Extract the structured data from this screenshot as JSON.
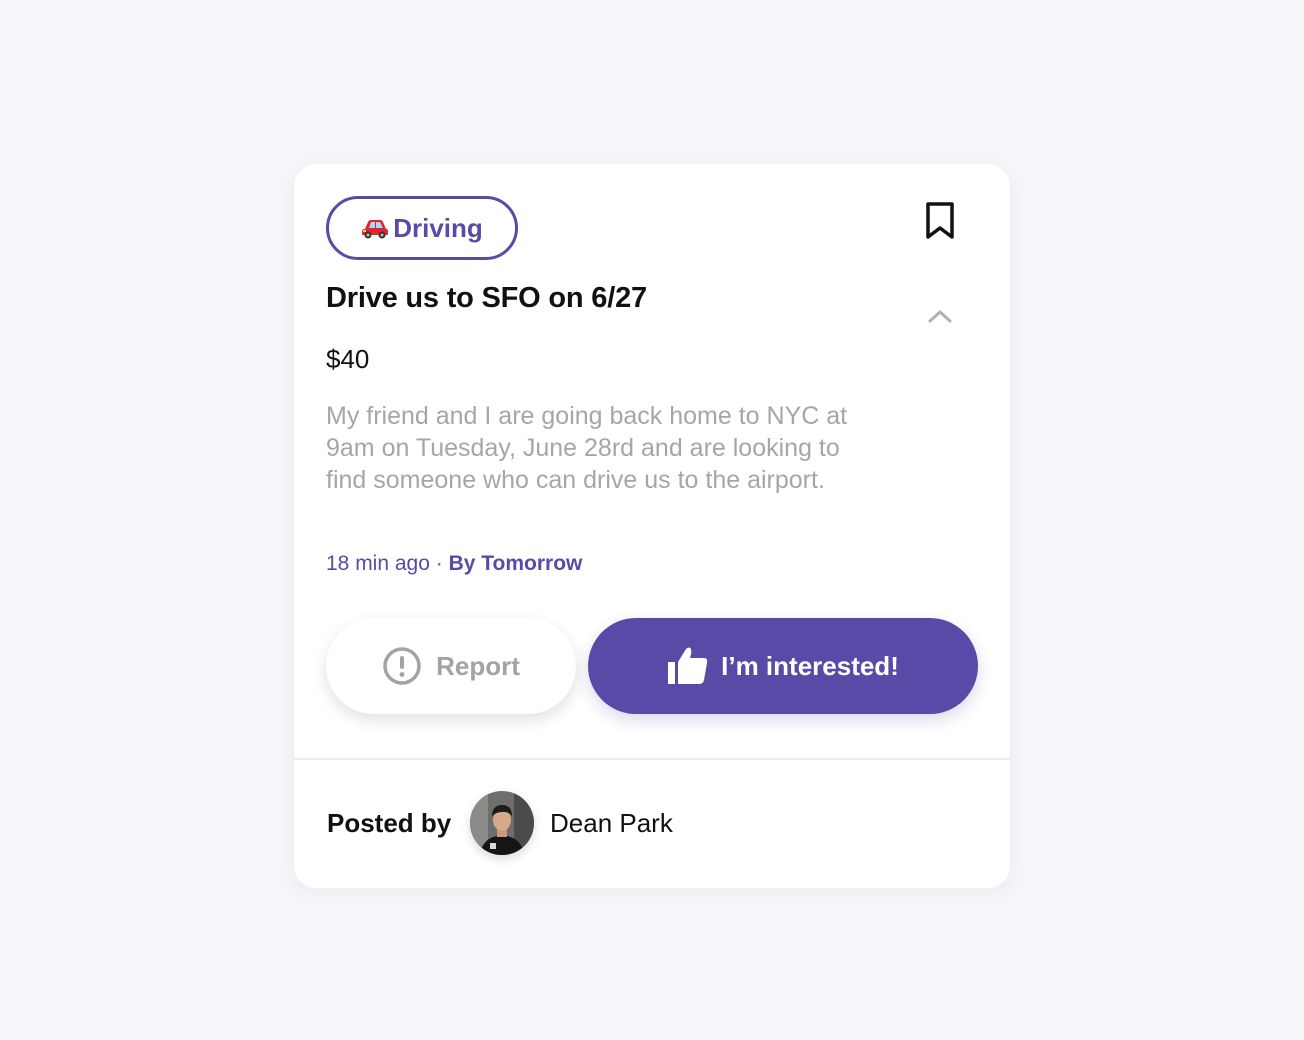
{
  "colors": {
    "accent": "#5a4aa8",
    "muted_text": "#a6a6a6",
    "background": "#f5f6fa",
    "card": "#ffffff"
  },
  "post": {
    "category": {
      "emoji_icon": "car-icon",
      "label": "Driving"
    },
    "title": "Drive us to SFO on 6/27",
    "price": "$40",
    "description": "My friend and I are going back home to NYC at 9am on Tuesday, June 28rd and are looking to find someone who can drive us to the airport.",
    "time_ago": "18 min ago",
    "separator": "·",
    "deadline": "By Tomorrow"
  },
  "actions": {
    "report_label": "Report",
    "report_icon": "alert-circle-icon",
    "interested_label": "I’m interested!",
    "interested_icon": "thumbs-up-icon",
    "bookmark_icon": "bookmark-icon",
    "collapse_icon": "chevron-up-icon"
  },
  "footer": {
    "posted_by_label": "Posted by",
    "author_name": "Dean Park"
  }
}
